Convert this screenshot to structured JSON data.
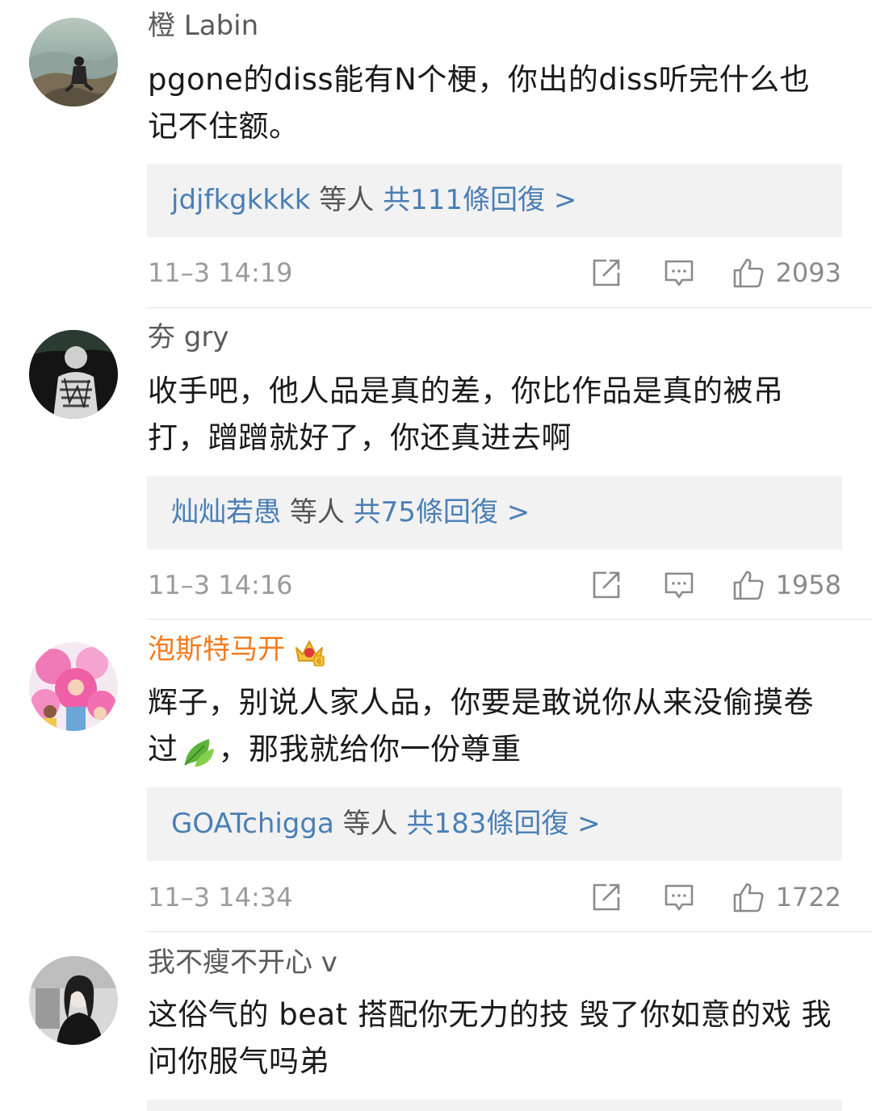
{
  "comments": [
    {
      "username": "橙 Labin",
      "text": "pgone的diss能有N个梗，你出的diss听完什么也记不住额。",
      "reply_names": "jdjfkgkkkk",
      "reply_mid": "等人",
      "reply_count": "共111條回復 >",
      "timestamp": "11–3 14:19",
      "likes": "2093"
    },
    {
      "username": "夯 gry",
      "text": "收手吧，他人品是真的差，你比作品是真的被吊打，蹭蹭就好了，你还真进去啊",
      "reply_names": "灿灿若愚",
      "reply_mid": "等人",
      "reply_count": "共75條回復 >",
      "timestamp": "11–3 14:16",
      "likes": "1958"
    },
    {
      "username": "泡斯特马开",
      "text_before": "辉子，别说人家人品，你要是敢说你从来没偷摸卷过",
      "text_after": "，那我就给你一份尊重",
      "reply_names": "GOATchigga",
      "reply_mid": "等人",
      "reply_count": "共183條回復 >",
      "timestamp": "11–3 14:34",
      "likes": "1722"
    },
    {
      "username": "我不瘦不开心 v",
      "text": "这俗气的 beat 搭配你无力的技 毁了你如意的戏 我问你服气吗弟"
    }
  ],
  "icons": {
    "share": "share-icon",
    "reply": "comment-icon",
    "like": "thumbs-up-icon",
    "vip": "crown-badge-icon",
    "emoji": "leaf-emoji-icon"
  },
  "colors": {
    "link": "#4a7fb5",
    "vip_name": "#f37b1d",
    "meta": "#9b9b9b",
    "reply_bg": "#f2f2f2"
  }
}
